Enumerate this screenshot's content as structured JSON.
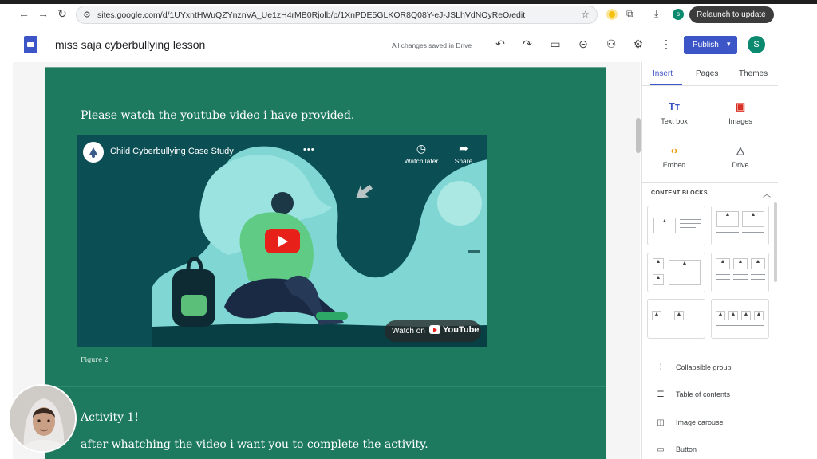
{
  "browser": {
    "url": "sites.google.com/d/1UYxntHWuQZYnznVA_Ue1zH4rMB0Rjolb/p/1XnPDE5GLKOR8Q08Y-eJ-JSLhVdNOyReO/edit",
    "relaunch_label": "Relaunch to update",
    "profile_initial": "s"
  },
  "sites": {
    "site_title": "miss saja cyberbullying lesson",
    "save_status": "All changes saved in Drive",
    "publish_label": "Publish",
    "user_initial": "S"
  },
  "page": {
    "heading": "Please watch the youtube video i have provided.",
    "figure_caption": "Figure 2",
    "activity_title": "Activity 1!",
    "activity_text": "after whatching the video i want you to complete the activity."
  },
  "video": {
    "title": "Child Cyberbullying Case Study",
    "watch_later": "Watch later",
    "share": "Share",
    "watch_on": "Watch on",
    "youtube": "YouTube"
  },
  "panel": {
    "tabs": [
      "Insert",
      "Pages",
      "Themes"
    ],
    "insert_items": [
      "Text box",
      "Images",
      "Embed",
      "Drive"
    ],
    "content_blocks_label": "CONTENT BLOCKS",
    "list_items": [
      "Collapsible group",
      "Table of contents",
      "Image carousel",
      "Button"
    ]
  },
  "colors": {
    "accent": "#3c55c7",
    "card_green": "#1e7a5e",
    "video_teal": "#0a4c52",
    "youtube_red": "#e8201a"
  }
}
